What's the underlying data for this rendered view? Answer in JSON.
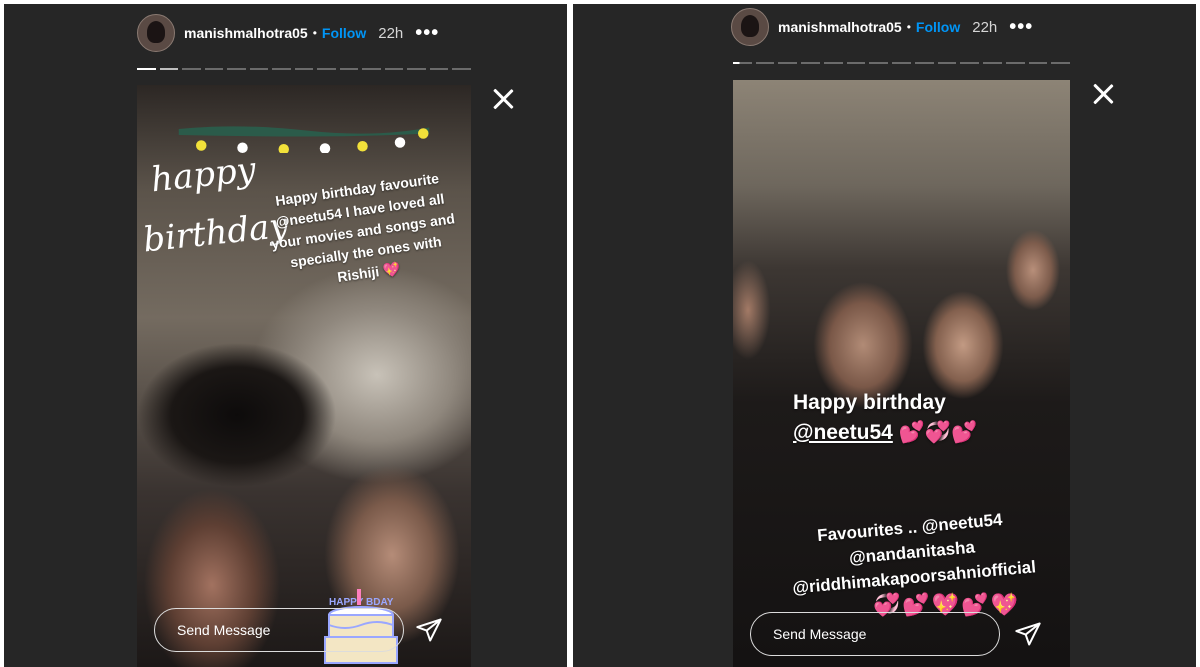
{
  "panels": [
    {
      "username": "manishmalhotra05",
      "separator": "•",
      "follow_label": "Follow",
      "time": "22h",
      "more_label": "•••",
      "progress_segments": 15,
      "caption_handwritten": [
        "happy",
        "birthday"
      ],
      "caption_text": "Happy birthday favourite @neetu54 I have loved all your movies and songs and specially the ones with Rishiji",
      "caption_emoji": "💖",
      "sticker_text": "HAPPY BDAY",
      "reply_placeholder": "Send Message"
    },
    {
      "username": "manishmalhotra05",
      "separator": "•",
      "follow_label": "Follow",
      "time": "22h",
      "more_label": "•••",
      "progress_segments": 15,
      "caption_main_line1": "Happy birthday",
      "caption_main_mention": "@neetu54",
      "caption_main_emoji": "💕💞💕",
      "caption_bottom_line1": "Favourites .. @neetu54",
      "caption_bottom_line2": "@nandanitasha",
      "caption_bottom_line3": "@riddhimakapoorsahniofficial",
      "caption_bottom_emoji": "💞💕💖💕💖",
      "reply_placeholder": "Send Message"
    }
  ],
  "colors": {
    "panel_bg": "#262626",
    "follow": "#0095f6",
    "progress_active": "#ffffff",
    "progress_inactive": "#6b6b6b"
  },
  "icons": [
    "close-icon",
    "send-icon",
    "more-icon",
    "avatar"
  ]
}
